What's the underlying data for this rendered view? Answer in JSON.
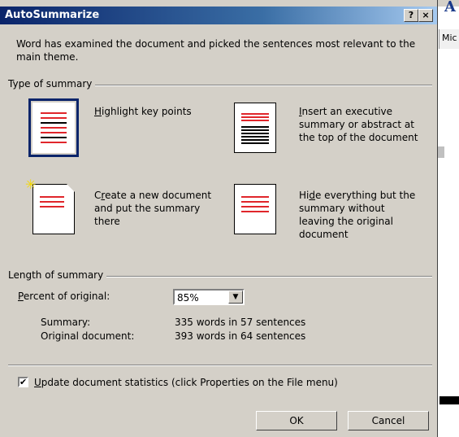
{
  "dialog": {
    "title": "AutoSummarize",
    "help_label": "?",
    "close_label": "×",
    "intro": "Word has examined the document and picked the sentences most relevant to the main theme."
  },
  "type_group": {
    "label": "Type of summary",
    "options": [
      {
        "hotkey": "H",
        "label_rest": "ighlight key points",
        "selected": true
      },
      {
        "hotkey": "I",
        "label_rest": "nsert an executive summary or abstract at the top of the document",
        "selected": false
      },
      {
        "pre": "C",
        "hotkey": "r",
        "label_rest": "eate a new document and put the summary there",
        "selected": false
      },
      {
        "pre": "Hi",
        "hotkey": "d",
        "label_rest": "e everything but the summary without leaving the original document",
        "selected": false
      }
    ]
  },
  "length_group": {
    "label": "Length of summary",
    "percent_label_hotkey": "P",
    "percent_label_rest": "ercent of original:",
    "percent_value": "85%",
    "summary_label": "Summary:",
    "summary_value": "335 words in 57 sentences",
    "original_label": "Original document:",
    "original_value": "393 words in 64 sentences"
  },
  "update_stats": {
    "checked": true,
    "hotkey": "U",
    "label_rest": "pdate document statistics (click Properties on the File menu)"
  },
  "buttons": {
    "ok": "OK",
    "cancel": "Cancel"
  },
  "background": {
    "window_text": "Mic",
    "toolbar_letter": "A"
  }
}
